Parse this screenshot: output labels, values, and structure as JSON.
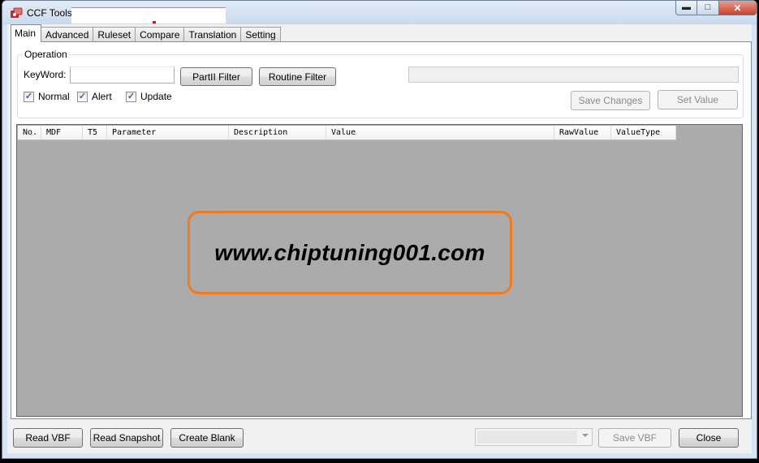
{
  "window": {
    "title": "CCF Tools",
    "icons": {
      "app": "ccf-tools-app-icon",
      "minimize": "minimize-icon",
      "maximize": "maximize-icon",
      "close": "close-icon"
    }
  },
  "tabs": [
    {
      "label": "Main",
      "active": true
    },
    {
      "label": "Advanced",
      "active": false
    },
    {
      "label": "Ruleset",
      "active": false
    },
    {
      "label": "Compare",
      "active": false
    },
    {
      "label": "Translation",
      "active": false
    },
    {
      "label": "Setting",
      "active": false
    }
  ],
  "operation": {
    "legend": "Operation",
    "keyword_label": "KeyWord:",
    "keyword_value": "",
    "partii_filter_label": "PartII Filter",
    "routine_filter_label": "Routine Filter",
    "value_field": "",
    "save_changes_label": "Save Changes",
    "set_value_label": "Set Value",
    "checkboxes": [
      {
        "label": "Normal",
        "checked": true
      },
      {
        "label": "Alert",
        "checked": true
      },
      {
        "label": "Update",
        "checked": true
      }
    ]
  },
  "grid": {
    "columns": [
      "No.",
      "MDF",
      "T5",
      "Parameter",
      "Description",
      "Value",
      "RawValue",
      "ValueType"
    ],
    "rows": []
  },
  "watermark": {
    "text": "www.chiptuning001.com",
    "border_color": "#f07b1d"
  },
  "bottom": {
    "read_vbf_label": "Read VBF",
    "read_snapshot_label": "Read Snapshot",
    "create_blank_label": "Create Blank",
    "combo_value": "",
    "save_vbf_label": "Save VBF",
    "close_label": "Close"
  }
}
